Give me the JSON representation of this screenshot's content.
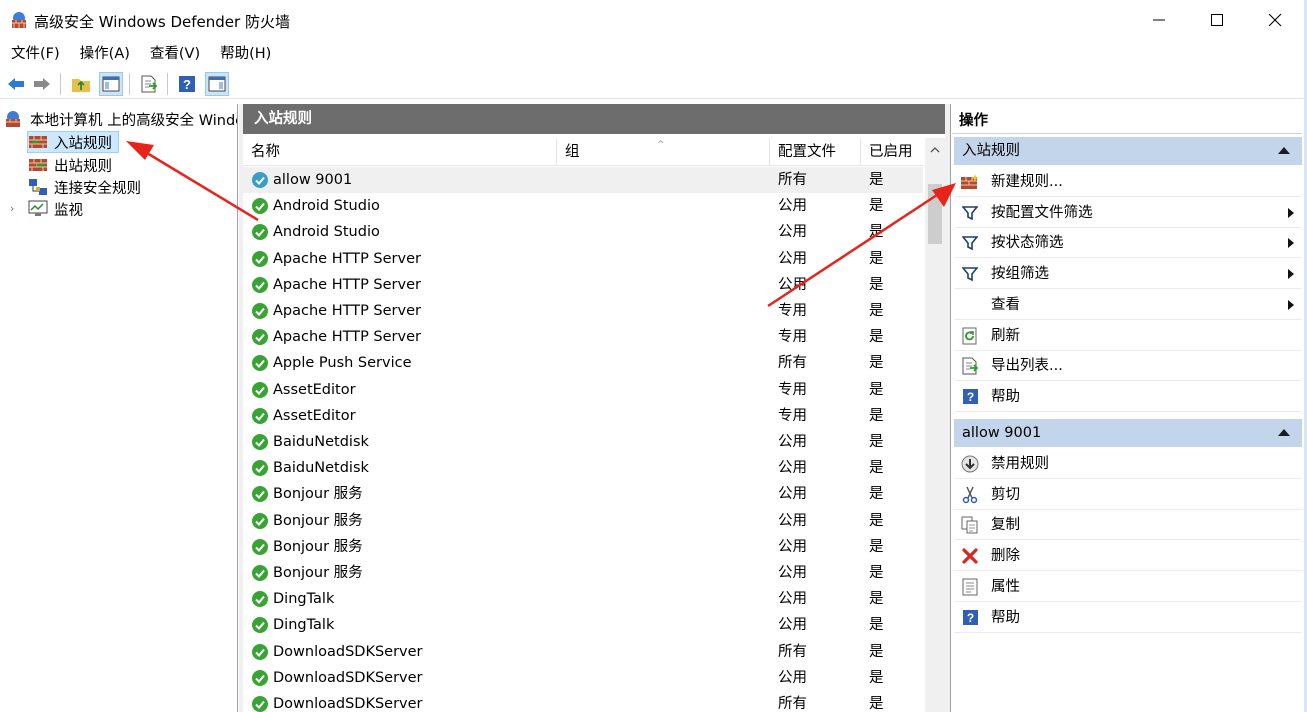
{
  "window": {
    "title": "高级安全 Windows Defender 防火墙",
    "icon": "firewall-icon"
  },
  "menu": [
    "文件(F)",
    "操作(A)",
    "查看(V)",
    "帮助(H)"
  ],
  "tree": {
    "root": "本地计算机 上的高级安全 Windows Defender 防火墙",
    "items": [
      {
        "label": "入站规则",
        "icon": "inbound-rules-icon",
        "selected": true
      },
      {
        "label": "出站规则",
        "icon": "outbound-rules-icon",
        "selected": false
      },
      {
        "label": "连接安全规则",
        "icon": "connection-security-icon",
        "selected": false
      },
      {
        "label": "监视",
        "icon": "monitor-icon",
        "selected": false
      }
    ]
  },
  "center": {
    "header": "入站规则",
    "columns": [
      "名称",
      "组",
      "配置文件",
      "已启用"
    ],
    "rows": [
      {
        "name": "allow 9001",
        "profile": "所有",
        "enabled": "是",
        "selected": true
      },
      {
        "name": "Android Studio",
        "profile": "公用",
        "enabled": "是"
      },
      {
        "name": "Android Studio",
        "profile": "公用",
        "enabled": "是"
      },
      {
        "name": "Apache HTTP Server",
        "profile": "公用",
        "enabled": "是"
      },
      {
        "name": "Apache HTTP Server",
        "profile": "公用",
        "enabled": "是"
      },
      {
        "name": "Apache HTTP Server",
        "profile": "专用",
        "enabled": "是"
      },
      {
        "name": "Apache HTTP Server",
        "profile": "专用",
        "enabled": "是"
      },
      {
        "name": "Apple Push Service",
        "profile": "所有",
        "enabled": "是"
      },
      {
        "name": "AssetEditor",
        "profile": "专用",
        "enabled": "是"
      },
      {
        "name": "AssetEditor",
        "profile": "专用",
        "enabled": "是"
      },
      {
        "name": "BaiduNetdisk",
        "profile": "公用",
        "enabled": "是"
      },
      {
        "name": "BaiduNetdisk",
        "profile": "公用",
        "enabled": "是"
      },
      {
        "name": "Bonjour 服务",
        "profile": "公用",
        "enabled": "是"
      },
      {
        "name": "Bonjour 服务",
        "profile": "公用",
        "enabled": "是"
      },
      {
        "name": "Bonjour 服务",
        "profile": "公用",
        "enabled": "是"
      },
      {
        "name": "Bonjour 服务",
        "profile": "公用",
        "enabled": "是"
      },
      {
        "name": "DingTalk",
        "profile": "公用",
        "enabled": "是"
      },
      {
        "name": "DingTalk",
        "profile": "公用",
        "enabled": "是"
      },
      {
        "name": "DownloadSDKServer",
        "profile": "所有",
        "enabled": "是"
      },
      {
        "name": "DownloadSDKServer",
        "profile": "公用",
        "enabled": "是"
      },
      {
        "name": "DownloadSDKServer",
        "profile": "所有",
        "enabled": "是"
      }
    ]
  },
  "actions": {
    "title": "操作",
    "section1": {
      "header": "入站规则",
      "items": [
        {
          "label": "新建规则...",
          "icon": "new-rule-icon",
          "submenu": false
        },
        {
          "label": "按配置文件筛选",
          "icon": "filter-icon",
          "submenu": true
        },
        {
          "label": "按状态筛选",
          "icon": "filter-icon",
          "submenu": true
        },
        {
          "label": "按组筛选",
          "icon": "filter-icon",
          "submenu": true
        },
        {
          "label": "查看",
          "icon": "",
          "submenu": true
        },
        {
          "label": "刷新",
          "icon": "refresh-icon",
          "submenu": false
        },
        {
          "label": "导出列表...",
          "icon": "export-icon",
          "submenu": false
        },
        {
          "label": "帮助",
          "icon": "help-icon",
          "submenu": false
        }
      ]
    },
    "section2": {
      "header": "allow 9001",
      "items": [
        {
          "label": "禁用规则",
          "icon": "disable-icon"
        },
        {
          "label": "剪切",
          "icon": "cut-icon"
        },
        {
          "label": "复制",
          "icon": "copy-icon"
        },
        {
          "label": "删除",
          "icon": "delete-icon"
        },
        {
          "label": "属性",
          "icon": "properties-icon"
        },
        {
          "label": "帮助",
          "icon": "help-icon"
        }
      ]
    }
  },
  "colors": {
    "accent_header": "#6d6d6d",
    "section_header": "#c2d5ea",
    "annotation": "#e8231b",
    "rule_enabled_green": "#3aa335"
  }
}
